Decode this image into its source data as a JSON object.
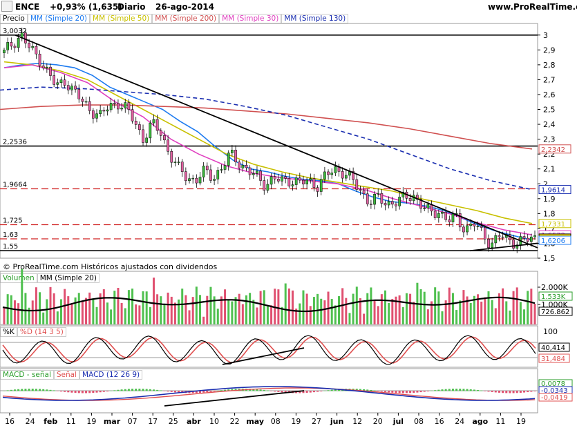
{
  "header": {
    "symbol": "ENCE",
    "change": "+0,93% (1,635)",
    "period": "Diario",
    "date": "26-ago-2014",
    "site": "www.ProRealTime.com"
  },
  "price_panel": {
    "legend": [
      {
        "label": "Precio",
        "color": "#000000"
      },
      {
        "label": "MM (Simple 20)",
        "color": "#1e7bf0"
      },
      {
        "label": "MM (Simple 50)",
        "color": "#c8c000"
      },
      {
        "label": "MM (Simple 200)",
        "color": "#d05050"
      },
      {
        "label": "MM (Simple 30)",
        "color": "#e040c0"
      },
      {
        "label": "MM (Simple 130)",
        "color": "#1a2eb0"
      }
    ],
    "copyright": "© ProRealTime.com  Históricos ajustados con dividendos",
    "y_ticks": [
      "3",
      "2,9",
      "2,8",
      "2,7",
      "2,6",
      "2,5",
      "2,4",
      "2,3",
      "2,2",
      "2,1",
      "2",
      "1,9",
      "1,8",
      "1,7",
      "1,6",
      "1,5"
    ],
    "levels": [
      {
        "label": "3,0032",
        "value": 3.0,
        "style": "solid"
      },
      {
        "label": "2,2536",
        "value": 2.2536,
        "style": "solid"
      },
      {
        "label": "1,9664",
        "value": 1.9664,
        "style": "dashed"
      },
      {
        "label": "1,725",
        "value": 1.725,
        "style": "dashed"
      },
      {
        "label": "1,63",
        "value": 1.63,
        "style": "dashed"
      },
      {
        "label": "1,55",
        "value": 1.55,
        "style": "solid"
      }
    ],
    "tags": [
      {
        "text": "2,2342",
        "value": 2.2342,
        "color": "#d05050"
      },
      {
        "text": "1,9614",
        "value": 1.9614,
        "color": "#1a2eb0"
      },
      {
        "text": "1,7331",
        "value": 1.7331,
        "color": "#c8c000"
      },
      {
        "text": "1,6572",
        "value": 1.6572,
        "color": "#e040c0"
      },
      {
        "text": "1,635",
        "value": 1.635,
        "color": "#000000"
      },
      {
        "text": "1,6206",
        "value": 1.6206,
        "color": "#1e7bf0"
      }
    ]
  },
  "volume_panel": {
    "legend": [
      {
        "label": "Volumen",
        "color": "#2a9d2a"
      },
      {
        "label": "MM (Simple 20)",
        "color": "#000000"
      }
    ],
    "y_ticks": [
      "2.000K",
      "1.000K"
    ],
    "tags": [
      {
        "text": "1.533K",
        "color": "#2a9d2a"
      },
      {
        "text": "726.862",
        "color": "#000000"
      }
    ]
  },
  "stoch_panel": {
    "legend": [
      {
        "label": "%K",
        "color": "#000000"
      },
      {
        "label": "%D (14 3 5)",
        "color": "#e05050"
      }
    ],
    "y_ticks": [
      "100"
    ],
    "tags": [
      {
        "text": "40,414",
        "color": "#000000"
      },
      {
        "text": "31,484",
        "color": "#e05050"
      }
    ]
  },
  "macd_panel": {
    "legend": [
      {
        "label": "MACD - señal",
        "color": "#2a9d2a"
      },
      {
        "label": "Señal",
        "color": "#e05050"
      },
      {
        "label": "MACD (12 26 9)",
        "color": "#1a2eb0"
      }
    ],
    "tags": [
      {
        "text": "0,0078",
        "color": "#2a9d2a"
      },
      {
        "text": "-0,0343",
        "color": "#1a2eb0"
      },
      {
        "text": "-0,0419",
        "color": "#e05050"
      }
    ]
  },
  "x_axis": {
    "labels": [
      "16",
      "24",
      "feb",
      "11",
      "19",
      "mar",
      "07",
      "17",
      "25",
      "abr",
      "10",
      "22",
      "may",
      "08",
      "19",
      "27",
      "jun",
      "12",
      "20",
      "jul",
      "08",
      "16",
      "24",
      "ago",
      "11",
      "19"
    ],
    "bold": [
      "feb",
      "mar",
      "abr",
      "may",
      "jun",
      "jul",
      "ago"
    ]
  },
  "chart_data": {
    "type": "candlestick",
    "series": [
      {
        "name": "Precio",
        "values": [
          2.88,
          2.95,
          3.0,
          2.9,
          2.85,
          2.75,
          2.65,
          2.7,
          2.62,
          2.55,
          2.5,
          2.45,
          2.52,
          2.55,
          2.5,
          2.42,
          2.3,
          2.4,
          2.35,
          2.2,
          2.1,
          2.05,
          2.02,
          2.08,
          2.05,
          2.1,
          2.2,
          2.15,
          2.08,
          2.05,
          2.0,
          2.03,
          2.02,
          2.03,
          2.0,
          2.02,
          1.99,
          2.05,
          2.1,
          2.08,
          2.02,
          1.95,
          1.88,
          1.9,
          1.87,
          1.88,
          1.9,
          1.93,
          1.85,
          1.8,
          1.82,
          1.75,
          1.77,
          1.7,
          1.73,
          1.66,
          1.6,
          1.65,
          1.62,
          1.61,
          1.62,
          1.635
        ]
      },
      {
        "name": "MM (Simple 20)",
        "values": [
          2.78,
          2.8,
          2.81,
          2.8,
          2.78,
          2.73,
          2.65,
          2.6,
          2.55,
          2.5,
          2.42,
          2.35,
          2.25,
          2.16,
          2.1,
          2.08,
          2.05,
          2.03,
          2.02,
          2.0,
          1.95,
          1.91,
          1.88,
          1.87,
          1.85,
          1.82,
          1.77,
          1.72,
          1.68,
          1.65,
          1.62
        ]
      },
      {
        "name": "MM (Simple 50)",
        "values": [
          2.82,
          2.8,
          2.76,
          2.7,
          2.6,
          2.5,
          2.4,
          2.3,
          2.2,
          2.13,
          2.08,
          2.04,
          2.01,
          1.98,
          1.95,
          1.9,
          1.86,
          1.82,
          1.77,
          1.733
        ]
      },
      {
        "name": "MM (Simple 200)",
        "values": [
          2.5,
          2.52,
          2.53,
          2.53,
          2.52,
          2.51,
          2.49,
          2.47,
          2.44,
          2.41,
          2.37,
          2.32,
          2.27,
          2.234
        ]
      },
      {
        "name": "MM (Simple 30)",
        "values": [
          2.78,
          2.8,
          2.75,
          2.68,
          2.55,
          2.45,
          2.3,
          2.2,
          2.12,
          2.07,
          2.04,
          2.02,
          2.0,
          1.96,
          1.9,
          1.85,
          1.8,
          1.74,
          1.69,
          1.657
        ]
      },
      {
        "name": "MM (Simple 130)",
        "values": [
          2.63,
          2.65,
          2.64,
          2.62,
          2.6,
          2.57,
          2.52,
          2.46,
          2.38,
          2.3,
          2.2,
          2.1,
          2.02,
          1.961
        ]
      }
    ],
    "ylim": [
      1.5,
      3.05
    ]
  }
}
